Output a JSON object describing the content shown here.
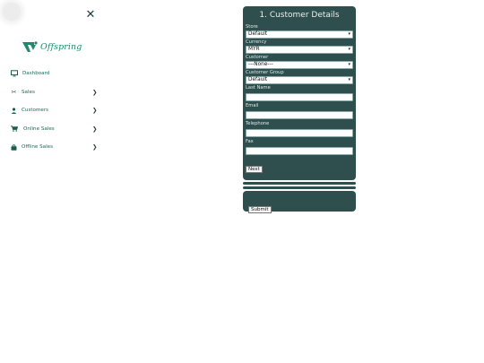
{
  "sidebar": {
    "brand": "Offspring",
    "items": [
      {
        "label": "Dashboard",
        "icon": "monitor-icon",
        "has_children": false
      },
      {
        "label": "Sales",
        "icon": "scissors-icon",
        "has_children": true
      },
      {
        "label": "Customers",
        "icon": "user-icon",
        "has_children": true
      },
      {
        "label": "Online Sales",
        "icon": "cart-icon",
        "has_children": true
      },
      {
        "label": "Offline Sales",
        "icon": "bag-icon",
        "has_children": true
      }
    ]
  },
  "form": {
    "title": "1. Customer Details",
    "store_label": "Store",
    "store_value": "Default",
    "currency_label": "Currency",
    "currency_value": "MYR",
    "customer_label": "Customer",
    "customer_value": "---None---",
    "group_label": "Customer Group",
    "group_value": "Default",
    "lastname_label": "Last Name",
    "email_label": "Email",
    "telephone_label": "Telephone",
    "fax_label": "Fax",
    "next_label": "Next",
    "submit_label": "Submit"
  },
  "colors": {
    "brand": "#1f8a6f",
    "panel": "#2e4f4d"
  }
}
